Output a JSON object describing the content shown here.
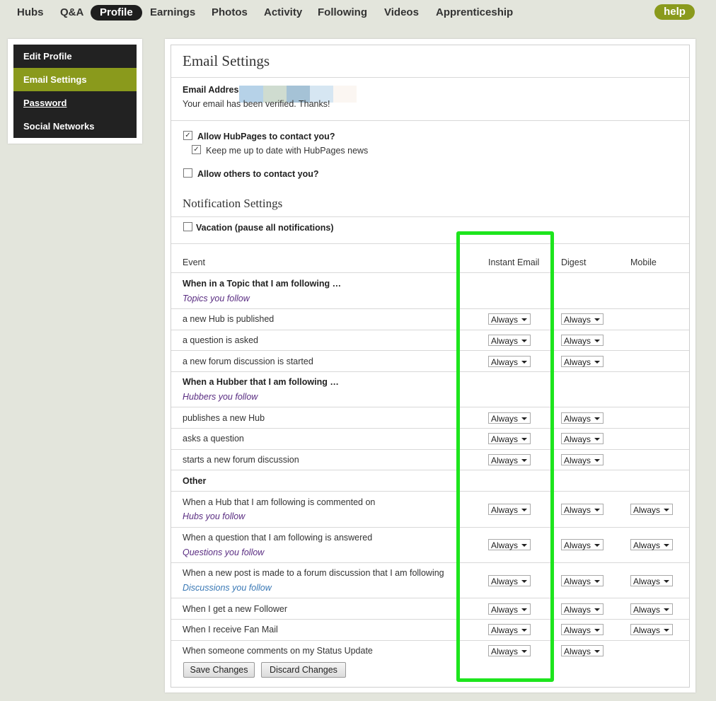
{
  "nav": {
    "items": [
      "Hubs",
      "Q&A",
      "Profile",
      "Earnings",
      "Photos",
      "Activity",
      "Following",
      "Videos",
      "Apprenticeship"
    ],
    "help": "help"
  },
  "sidebar": {
    "items": [
      "Edit Profile",
      "Email Settings",
      "Password",
      "Social Networks"
    ]
  },
  "email": {
    "title": "Email Settings",
    "address_label": "Email Address",
    "verified": "Your email has been verified. Thanks!",
    "swatch_colors": [
      "#b6d2e8",
      "#cfdcd0",
      "#a5c2d6",
      "#d6e6f2",
      "#fbf6f2"
    ]
  },
  "contact": {
    "allow_hubpages": "Allow HubPages to contact you?",
    "keep_up": "Keep me up to date with HubPages news",
    "allow_others": "Allow others to contact you?"
  },
  "notifications": {
    "title": "Notification Settings",
    "vacation": "Vacation (pause all notifications)",
    "col_event": "Event",
    "col_instant": "Instant Email",
    "col_digest": "Digest",
    "col_mobile": "Mobile",
    "topic_header": "When in a Topic that I am following …",
    "topic_link": "Topics you follow",
    "topic_rows": [
      "a new Hub is published",
      "a question is asked",
      "a new forum discussion is started"
    ],
    "hubber_header": "When a Hubber that I am following …",
    "hubber_link": "Hubbers you follow",
    "hubber_rows": [
      "publishes a new Hub",
      "asks a question",
      "starts a new forum discussion"
    ],
    "other_header": "Other",
    "other_rows": [
      {
        "label": "When a Hub that I am following is commented on",
        "link": "Hubs you follow"
      },
      {
        "label": "When a question that I am following is answered",
        "link": "Questions you follow"
      },
      {
        "label": "When a new post is made to a forum discussion that I am following",
        "link": "Discussions you follow"
      },
      {
        "label": "When I get a new Follower"
      },
      {
        "label": "When I receive Fan Mail"
      },
      {
        "label": "When someone comments on my Status Update"
      }
    ],
    "option": "Always"
  },
  "buttons": {
    "save": "Save Changes",
    "discard": "Discard Changes"
  },
  "colors": {
    "accent": "#8a9a1c",
    "highlight": "#1de51d"
  }
}
